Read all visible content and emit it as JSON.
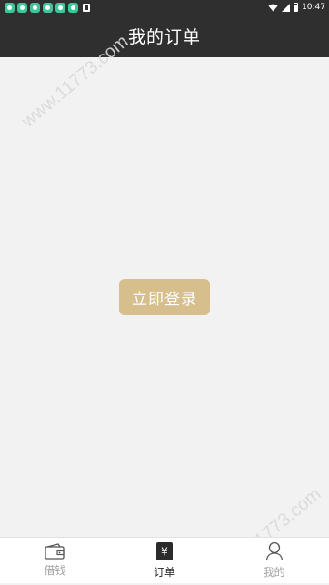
{
  "status_bar": {
    "notification_icons": [
      "app-notification-icon",
      "app-notification-icon",
      "app-notification-icon",
      "app-notification-icon",
      "app-notification-icon",
      "app-notification-icon",
      "download-notification-icon"
    ],
    "time": "10:47"
  },
  "header": {
    "title": "我的订单"
  },
  "main": {
    "login_button_label": "立即登录"
  },
  "watermark": {
    "text": "www.11773.com"
  },
  "tab_bar": {
    "tabs": [
      {
        "label": "借钱",
        "icon": "wallet-icon",
        "active": false
      },
      {
        "label": "订单",
        "icon": "order-yen-icon",
        "active": true
      },
      {
        "label": "我的",
        "icon": "person-icon",
        "active": false
      }
    ]
  },
  "colors": {
    "header_bg": "#2f2f2f",
    "page_bg": "#f2f2f2",
    "accent": "#d6bf8d",
    "tab_inactive": "#a3a3a3",
    "tab_active": "#2b2b2b"
  }
}
